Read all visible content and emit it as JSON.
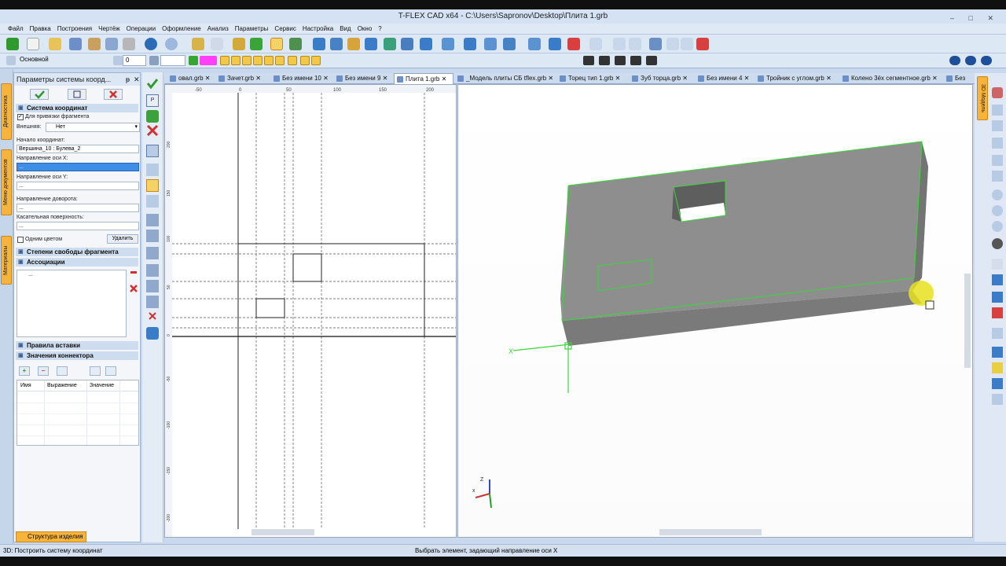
{
  "window": {
    "title": "T-FLEX CAD x64 - C:\\Users\\Sapronov\\Desktop\\Плита 1.grb",
    "controls": [
      "–",
      "□",
      "✕"
    ]
  },
  "menu": [
    "Файл",
    "Правка",
    "Построения",
    "Чертёж",
    "Операции",
    "Оформление",
    "Анализ",
    "Параметры",
    "Сервис",
    "Настройка",
    "Вид",
    "Окно",
    "?"
  ],
  "toolbar2": {
    "style_value": "Основной",
    "layer_value": "0"
  },
  "left_tabs": [
    "Диагностика",
    "Меню документов",
    "Материалы"
  ],
  "panel": {
    "title": "Параметры системы коорд...",
    "pin": "ᵽ",
    "close": "✕",
    "ok_icon": "checkmark-icon",
    "cancel_icon": "close-icon",
    "section_coords": "Система координат",
    "checkbox_fragment": "Для привязки фрагмента",
    "external_label": "Внешняя:",
    "external_value": "Нет",
    "origin_label": "Начало координат:",
    "origin_value": "Вершина_10 : Булева_2",
    "x_dir_label": "Направление оси X:",
    "x_dir_value": "...",
    "y_dir_label": "Направление оси Y:",
    "y_dir_value": "...",
    "turn_label": "Направление доворота:",
    "turn_value": "...",
    "tangent_label": "Касательная поверхность:",
    "tangent_value": "...",
    "one_color": "Одним цветом",
    "delete_btn": "Удалить",
    "section_dof": "Степени свободы фрагмента",
    "section_assoc": "Ассоциации",
    "assoc_item": "...",
    "section_insert": "Правила вставки",
    "section_connector": "Значения коннектора",
    "col_name": "Имя",
    "col_expr": "Выражение",
    "col_value": "Значение"
  },
  "doc_tabs": [
    "овал.grb",
    "Зачет.grb",
    "Без имени 10",
    "Без имени 9",
    "Плита 1.grb",
    "_Модель плиты СБ tflex.grb",
    "Торец тип 1.grb",
    "Зуб торца.grb",
    "Без имени 4",
    "Тройник с углом.grb",
    "Колено 3ёх сегментное.grb",
    "Без"
  ],
  "active_tab_index": 4,
  "view2d": {
    "ruler_top": [
      "-50",
      "0",
      "50",
      "100",
      "150",
      "200"
    ],
    "ruler_left": [
      "200",
      "150",
      "100",
      "50",
      "0",
      "-50",
      "-100",
      "-150",
      "-200"
    ]
  },
  "view3d": {
    "axis_x": "X",
    "triad_z": "Z",
    "triad_x": "x"
  },
  "right_tab": "3D Модель",
  "bottom_tab": "Структура изделия",
  "status": {
    "left": "3D: Построить систему координат",
    "center": "Выбрать элемент, задающий направление оси X"
  },
  "colors": {
    "accent_orange": "#f6b43c",
    "model_edge_green": "#39d839",
    "model_face": "#8e8e8e",
    "highlight_yellow": "#e8e020",
    "toolbar_bg": "#dde8f5"
  }
}
